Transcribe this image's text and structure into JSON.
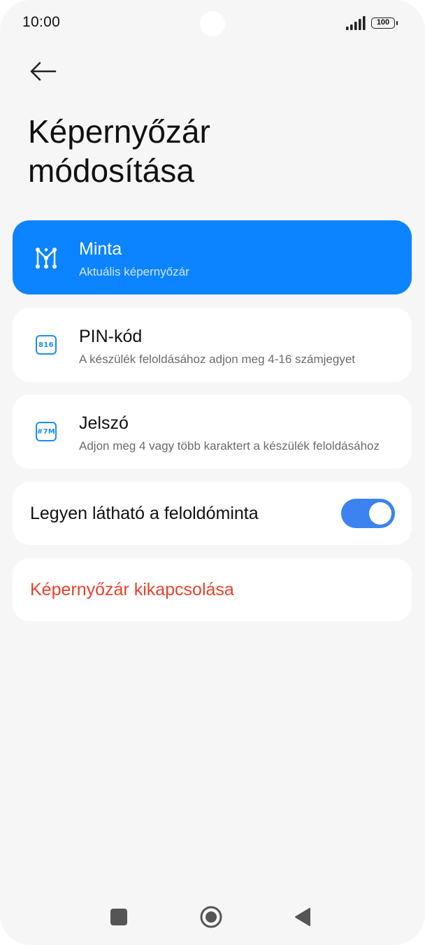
{
  "status_bar": {
    "time": "10:00",
    "battery": "100"
  },
  "header": {
    "back_icon": "arrow-left-icon",
    "title_line1": "Képernyőzár",
    "title_line2": "módosítása"
  },
  "options": [
    {
      "icon": "pattern-icon",
      "title": "Minta",
      "subtitle": "Aktuális képernyőzár",
      "selected": true
    },
    {
      "icon": "pin-icon",
      "icon_text": "816",
      "title": "PIN-kód",
      "subtitle": "A készülék feloldásához adjon meg 4-16 számjegyet",
      "selected": false
    },
    {
      "icon": "password-icon",
      "icon_text": "#7M",
      "title": "Jelszó",
      "subtitle": "Adjon meg 4 vagy több karaktert a készülék feloldásához",
      "selected": false
    }
  ],
  "visible_pattern": {
    "label": "Legyen látható a feloldóminta",
    "enabled": true
  },
  "disable_lock": {
    "label": "Képernyőzár kikapcsolása"
  },
  "nav": {
    "recents_icon": "square-icon",
    "home_icon": "circle-icon",
    "back_icon": "triangle-back-icon"
  },
  "colors": {
    "accent": "#0d84ff",
    "toggle": "#3c82f0",
    "danger": "#e8412c",
    "background": "#f6f6f6"
  }
}
